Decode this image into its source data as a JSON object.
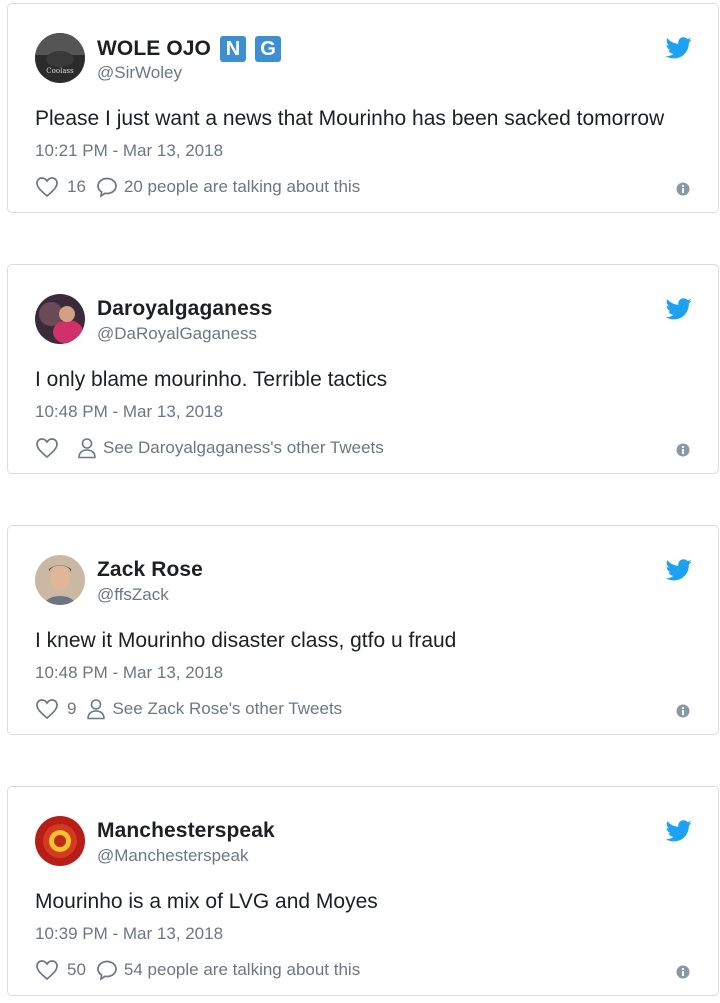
{
  "tweets": [
    {
      "name": "WOLE OJO",
      "badges": [
        "N",
        "G"
      ],
      "handle": "@SirWoley",
      "text": "Please I just want a news that Mourinho has been sacked tomorrow",
      "time": "10:21 PM - Mar 13, 2018",
      "likes": "16",
      "action_text": "20 people are talking about this",
      "avatar_color": "#2b2b2b",
      "avatar_label": "Coolass"
    },
    {
      "name": "Daroyalgaganess",
      "handle": "@DaRoyalGaganess",
      "text": "I only blame mourinho. Terrible tactics",
      "time": "10:48 PM - Mar 13, 2018",
      "likes": "",
      "action_text": "See Daroyalgaganess's other Tweets",
      "avatar_color": "#c4305a"
    },
    {
      "name": "Zack Rose",
      "handle": "@ffsZack",
      "text": "I knew it Mourinho disaster class, gtfo u fraud",
      "time": "10:48 PM - Mar 13, 2018",
      "likes": "9",
      "action_text": "See Zack Rose's other Tweets",
      "avatar_color": "#b9a38e"
    },
    {
      "name": "Manchesterspeak",
      "handle": "@Manchesterspeak",
      "text": "Mourinho is a mix of LVG and Moyes",
      "time": "10:39 PM - Mar 13, 2018",
      "likes": "50",
      "action_text": "54 people are talking about this",
      "avatar_color": "#b81d18"
    }
  ],
  "colors": {
    "twitter_blue": "#1da1f2",
    "badge_blue": "#3d8fd1",
    "meta_gray": "#697882",
    "border": "#d8dde2"
  },
  "icons": [
    "twitter-bird-icon",
    "heart-icon",
    "speech-bubble-icon",
    "person-icon",
    "info-icon"
  ]
}
